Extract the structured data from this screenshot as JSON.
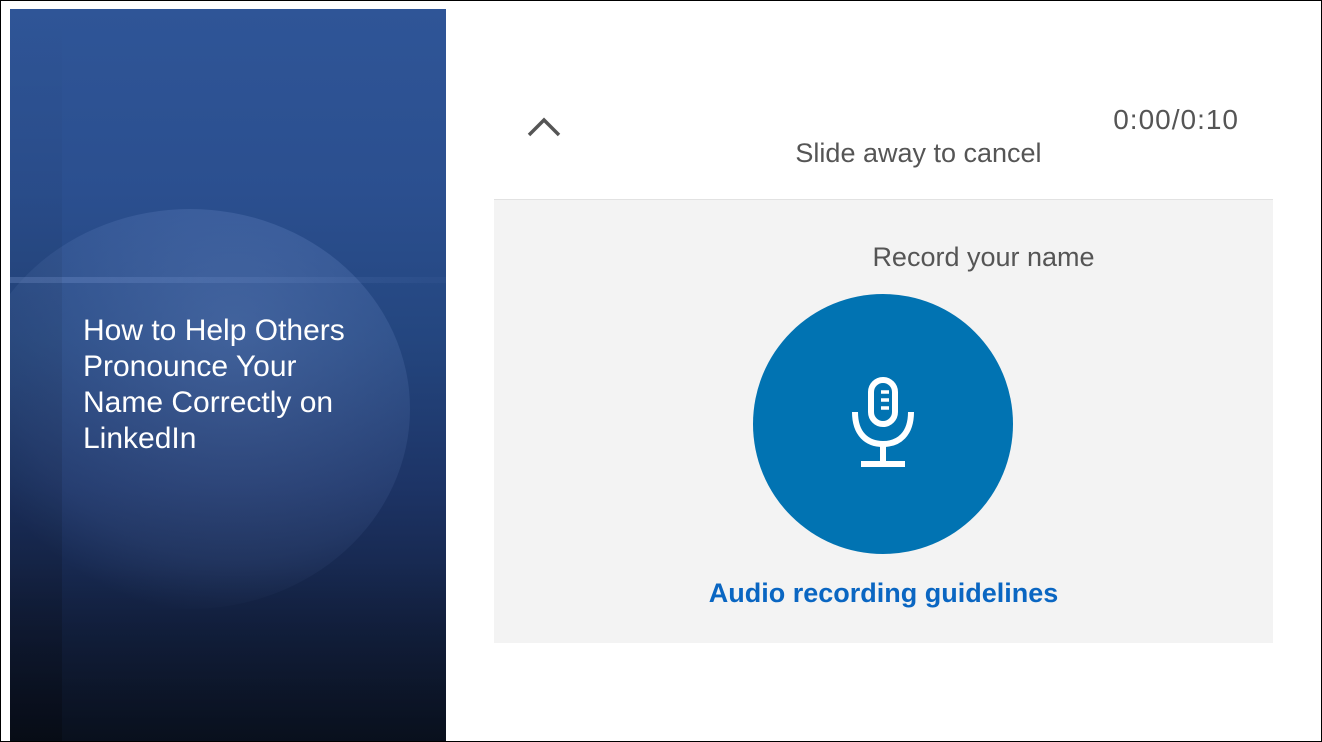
{
  "slide": {
    "title": "How to Help Others Pronounce Your Name Correctly on LinkedIn"
  },
  "recorder": {
    "timer": "0:00/0:10",
    "slide_hint": "Slide away to cancel",
    "record_label": "Record your name",
    "guidelines_link": "Audio recording guidelines",
    "icons": {
      "collapse": "chevron-up-icon",
      "record": "microphone-icon"
    }
  },
  "colors": {
    "slide_bg_top": "#2f5597",
    "slide_bg_bottom": "#0c1526",
    "mic_button": "#0173b2",
    "link": "#0a66c2",
    "panel": "#f3f3f3",
    "text": "#555555"
  }
}
